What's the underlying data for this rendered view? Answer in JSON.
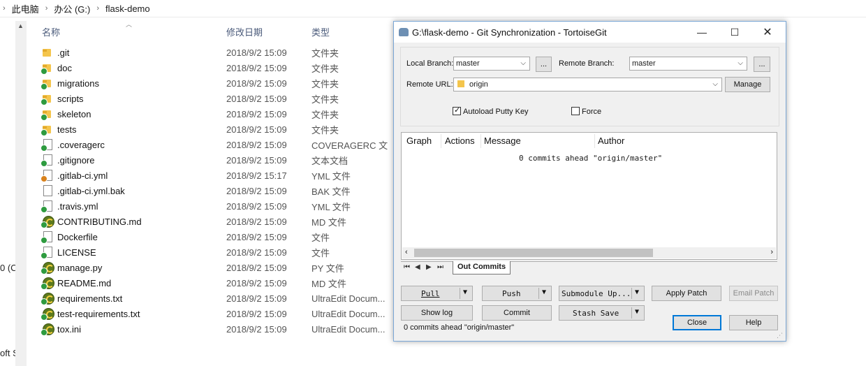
{
  "breadcrumb": {
    "items": [
      "此电脑",
      "办公 (G:)",
      "flask-demo"
    ]
  },
  "left_edge": {
    "text1": "0 (C",
    "text2": "oft S"
  },
  "columns": {
    "name": "名称",
    "date": "修改日期",
    "type": "类型"
  },
  "files": [
    {
      "name": ".git",
      "date": "2018/9/2 15:09",
      "type": "文件夹",
      "icon": "folder-icon",
      "status": "none"
    },
    {
      "name": "doc",
      "date": "2018/9/2 15:09",
      "type": "文件夹",
      "icon": "folder-icon",
      "status": "ok"
    },
    {
      "name": "migrations",
      "date": "2018/9/2 15:09",
      "type": "文件夹",
      "icon": "folder-icon",
      "status": "ok"
    },
    {
      "name": "scripts",
      "date": "2018/9/2 15:09",
      "type": "文件夹",
      "icon": "folder-icon",
      "status": "ok"
    },
    {
      "name": "skeleton",
      "date": "2018/9/2 15:09",
      "type": "文件夹",
      "icon": "folder-icon",
      "status": "ok"
    },
    {
      "name": "tests",
      "date": "2018/9/2 15:09",
      "type": "文件夹",
      "icon": "folder-icon",
      "status": "ok"
    },
    {
      "name": ".coveragerc",
      "date": "2018/9/2 15:09",
      "type": "COVERAGERC 文",
      "icon": "document-icon",
      "status": "ok"
    },
    {
      "name": ".gitignore",
      "date": "2018/9/2 15:09",
      "type": "文本文档",
      "icon": "document-icon",
      "status": "ok"
    },
    {
      "name": ".gitlab-ci.yml",
      "date": "2018/9/2 15:17",
      "type": "YML 文件",
      "icon": "document-icon",
      "status": "warn"
    },
    {
      "name": ".gitlab-ci.yml.bak",
      "date": "2018/9/2 15:09",
      "type": "BAK 文件",
      "icon": "document-icon",
      "status": "none"
    },
    {
      "name": ".travis.yml",
      "date": "2018/9/2 15:09",
      "type": "YML 文件",
      "icon": "document-icon",
      "status": "ok"
    },
    {
      "name": "CONTRIBUTING.md",
      "date": "2018/9/2 15:09",
      "type": "MD 文件",
      "icon": "python-ultraedit-icon",
      "status": "ok"
    },
    {
      "name": "Dockerfile",
      "date": "2018/9/2 15:09",
      "type": "文件",
      "icon": "document-icon",
      "status": "ok"
    },
    {
      "name": "LICENSE",
      "date": "2018/9/2 15:09",
      "type": "文件",
      "icon": "document-icon",
      "status": "ok"
    },
    {
      "name": "manage.py",
      "date": "2018/9/2 15:09",
      "type": "PY 文件",
      "icon": "python-ultraedit-icon",
      "status": "ok"
    },
    {
      "name": "README.md",
      "date": "2018/9/2 15:09",
      "type": "MD 文件",
      "icon": "python-ultraedit-icon",
      "status": "ok"
    },
    {
      "name": "requirements.txt",
      "date": "2018/9/2 15:09",
      "type": "UltraEdit Docum...",
      "icon": "python-ultraedit-icon",
      "status": "ok"
    },
    {
      "name": "test-requirements.txt",
      "date": "2018/9/2 15:09",
      "type": "UltraEdit Docum...",
      "icon": "python-ultraedit-icon",
      "status": "ok"
    },
    {
      "name": "tox.ini",
      "date": "2018/9/2 15:09",
      "type": "UltraEdit Docum...",
      "icon": "python-ultraedit-icon",
      "status": "ok"
    }
  ],
  "dialog": {
    "title": "G:\\flask-demo - Git Synchronization - TortoiseGit",
    "local_branch_label": "Local Branch:",
    "local_branch_value": "master",
    "browse1": "...",
    "remote_branch_label": "Remote Branch:",
    "remote_branch_value": "master",
    "browse2": "...",
    "remote_url_label": "Remote URL:",
    "remote_url_value": "origin",
    "manage": "Manage",
    "autoload_label": "Autoload Putty Key",
    "autoload_checked": true,
    "force_label": "Force",
    "force_checked": false,
    "grid_headers": [
      "Graph",
      "Actions",
      "Message",
      "Author"
    ],
    "grid_message": "0 commits ahead \"origin/master\"",
    "tab": "Out Commits",
    "pull": "Pull",
    "push": "Push",
    "submodule": "Submodule Up...",
    "apply_patch": "Apply Patch",
    "email_patch": "Email Patch",
    "show_log": "Show log",
    "commit": "Commit",
    "stash_save": "Stash Save",
    "close": "Close",
    "help": "Help",
    "status": "0 commits ahead \"origin/master\""
  }
}
